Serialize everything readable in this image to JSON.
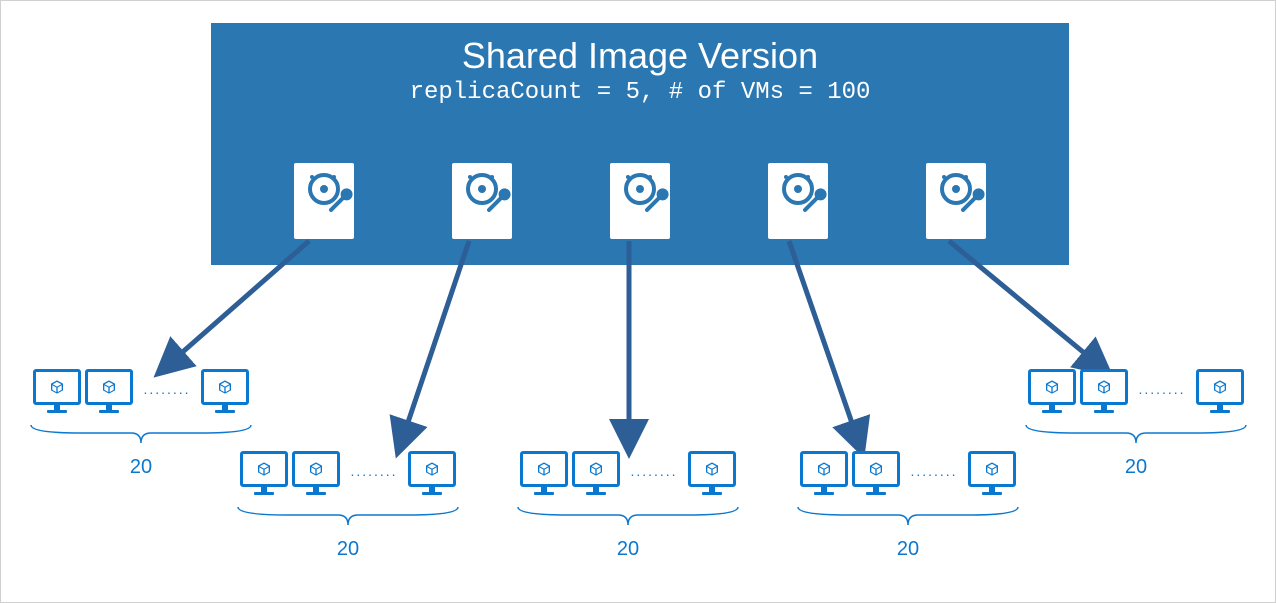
{
  "header": {
    "title": "Shared Image Version",
    "subtitle": "replicaCount = 5, # of VMs = 100",
    "replicaCount": 5,
    "totalVMs": 100
  },
  "groups": [
    {
      "count": "20"
    },
    {
      "count": "20"
    },
    {
      "count": "20"
    },
    {
      "count": "20"
    },
    {
      "count": "20"
    }
  ],
  "ellipsis": "........",
  "colors": {
    "headerBg": "#2a77b1",
    "accent": "#0b78d0",
    "arrow": "#2d5e95"
  }
}
